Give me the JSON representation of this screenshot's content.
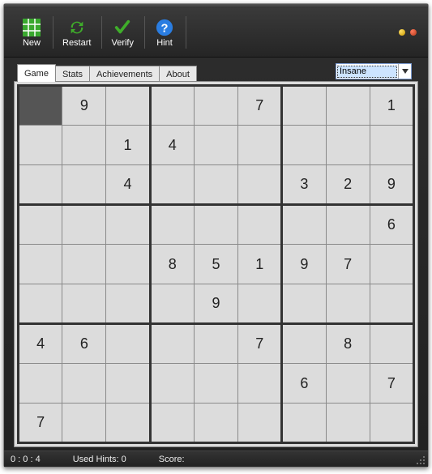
{
  "toolbar": {
    "new": "New",
    "restart": "Restart",
    "verify": "Verify",
    "hint": "Hint"
  },
  "tabs": {
    "game": "Game",
    "stats": "Stats",
    "achievements": "Achievements",
    "about": "About",
    "active": "game"
  },
  "difficulty": {
    "selected": "Insane"
  },
  "board": {
    "cursor": [
      0,
      0
    ],
    "cells": [
      [
        "",
        "9",
        "",
        "",
        "",
        "7",
        "",
        "",
        "1"
      ],
      [
        "",
        "",
        "1",
        "4",
        "",
        "",
        "",
        "",
        ""
      ],
      [
        "",
        "",
        "4",
        "",
        "",
        "",
        "3",
        "2",
        ""
      ],
      [
        "",
        "",
        "",
        "",
        "",
        "",
        "",
        "",
        ""
      ],
      [
        "",
        "",
        "",
        "8",
        "5",
        "1",
        "9",
        "7",
        ""
      ],
      [
        "",
        "",
        "",
        "",
        "9",
        "",
        "",
        "",
        ""
      ],
      [
        "4",
        "6",
        "",
        "",
        "",
        "7",
        "",
        "8",
        ""
      ],
      [
        "",
        "",
        "",
        "",
        "",
        "",
        "6",
        "",
        ""
      ],
      [
        "7",
        "",
        "",
        "",
        "",
        "",
        "",
        "",
        ""
      ]
    ],
    "box_row9": [
      "",
      "9",
      "6",
      "",
      "7",
      ""
    ]
  },
  "status": {
    "time": "0 : 0 : 4",
    "hints": "Used Hints: 0",
    "score": "Score:"
  },
  "colors": {
    "window_bg": "#222222",
    "board_bg": "#dcdcdc",
    "line_dark": "#333333"
  }
}
